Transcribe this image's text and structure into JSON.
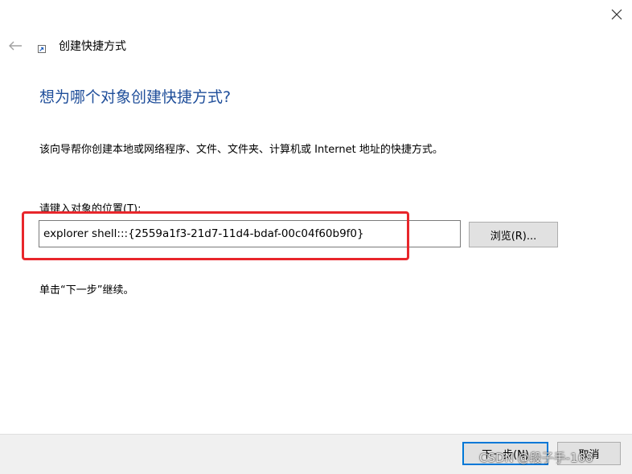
{
  "window": {
    "title": "创建快捷方式"
  },
  "page": {
    "heading": "想为哪个对象创建快捷方式?",
    "description": "该向导帮你创建本地或网络程序、文件、文件夹、计算机或 Internet 地址的快捷方式。",
    "location_label": "请键入对象的位置(T):",
    "location_value": "explorer shell:::{2559a1f3-21d7-11d4-bdaf-00c04f60b9f0}",
    "browse_label": "浏览(R)...",
    "continue_hint": "单击“下一步”继续。"
  },
  "footer": {
    "next_label": "下一步(N)",
    "cancel_label": "取消"
  },
  "watermark": {
    "text": "CSDN @段子手-168"
  },
  "colors": {
    "heading": "#1f4e9a",
    "annotation": "#e8262b",
    "default_button_border": "#0078d7",
    "footer_bg": "#f0f0f0"
  },
  "icons": {
    "close": "close-icon",
    "back": "back-arrow-icon",
    "title": "shortcut-icon"
  }
}
